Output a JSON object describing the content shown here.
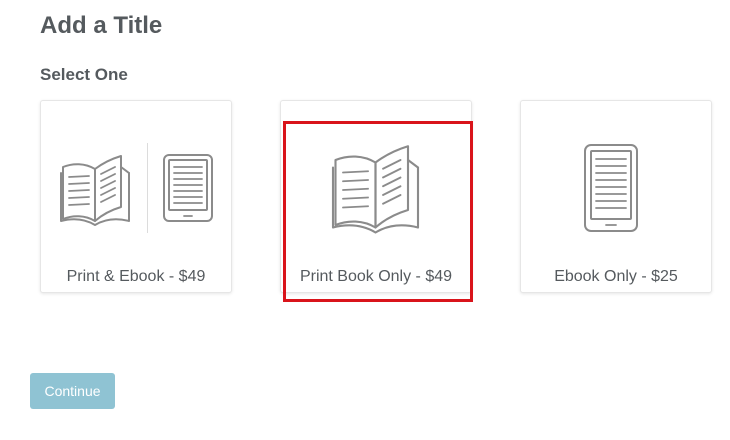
{
  "page": {
    "title": "Add a Title",
    "section_label": "Select One"
  },
  "options": [
    {
      "label": "Print & Ebook - $49",
      "icons": [
        "open-book-icon",
        "ereader-icon"
      ],
      "selected": false
    },
    {
      "label": "Print Book Only - $49",
      "icons": [
        "open-book-icon"
      ],
      "selected": true
    },
    {
      "label": "Ebook Only - $25",
      "icons": [
        "ereader-icon"
      ],
      "selected": false
    }
  ],
  "actions": {
    "continue_label": "Continue"
  },
  "colors": {
    "text": "#555a5e",
    "icon": "#8b8b8b",
    "card_border": "#e6e6e6",
    "highlight": "#d9141b",
    "continue_button": "#8fc3d3"
  }
}
